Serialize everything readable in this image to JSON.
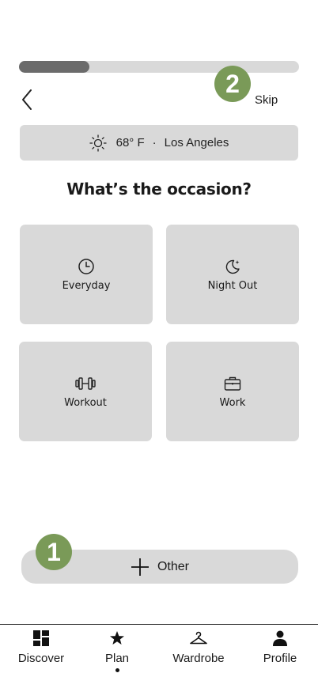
{
  "progress": {
    "value": 0.25
  },
  "header": {
    "skip_label": "Skip"
  },
  "badges": {
    "step_1": "1",
    "step_2": "2"
  },
  "weather": {
    "temperature": "68° F",
    "separator": "·",
    "location": "Los Angeles",
    "icon": "sun-icon"
  },
  "question": "What’s the occasion?",
  "occasions": [
    {
      "label": "Everyday",
      "icon": "clock-icon"
    },
    {
      "label": "Night Out",
      "icon": "moon-stars-icon"
    },
    {
      "label": "Workout",
      "icon": "dumbbell-icon"
    },
    {
      "label": "Work",
      "icon": "briefcase-icon"
    }
  ],
  "other_button": {
    "label": "Other",
    "icon": "plus-icon"
  },
  "nav": {
    "items": [
      {
        "label": "Discover",
        "icon": "grid-icon"
      },
      {
        "label": "Plan",
        "icon": "star-icon"
      },
      {
        "label": "Wardrobe",
        "icon": "hanger-icon"
      },
      {
        "label": "Profile",
        "icon": "person-icon"
      }
    ],
    "active_index": 1
  },
  "colors": {
    "accent_badge": "#7a9a58",
    "surface": "#d9d9d9",
    "progress_fill": "#6b6b6b"
  }
}
